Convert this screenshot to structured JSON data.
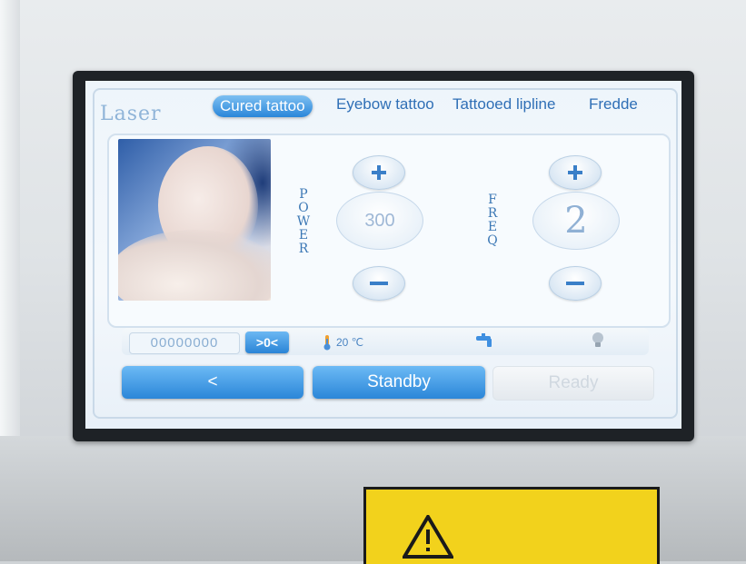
{
  "screen": {
    "brand": "Laser",
    "tabs": [
      {
        "label": "Cured tattoo",
        "active": true
      },
      {
        "label": "Eyebow tattoo",
        "active": false
      },
      {
        "label": "Tattooed lipline",
        "active": false
      },
      {
        "label": "Fredde",
        "active": false
      }
    ],
    "power": {
      "label_letters": [
        "P",
        "O",
        "W",
        "E",
        "R"
      ],
      "value": "300"
    },
    "freq": {
      "label_letters": [
        "F",
        "R",
        "E",
        "Q"
      ],
      "value": "2"
    },
    "status": {
      "counter": "00000000",
      "reset_label": ">0<",
      "temperature": "20 ℃"
    },
    "buttons": {
      "back": "<",
      "standby": "Standby",
      "ready": "Ready"
    }
  },
  "colors": {
    "accent": "#2a86d9",
    "label_blue": "#3c78b5",
    "sticker_yellow": "#f2d21c"
  },
  "icons": [
    "plus-icon",
    "minus-icon",
    "thermometer-icon",
    "water-tap-icon",
    "lamp-icon",
    "warning-triangle-icon"
  ]
}
